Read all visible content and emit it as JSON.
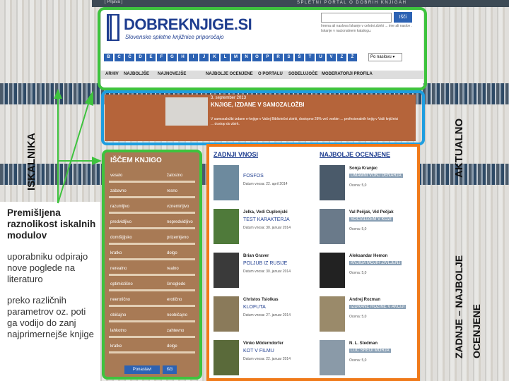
{
  "top_bar": {
    "login": "[ Prijava ]",
    "portal": "SPLETNI PORTAL O DOBRIH KNJIGAH"
  },
  "header": {
    "logo": "DOBREKNJIGE.SI",
    "tagline": "Slovenske spletne knjižnice priporočajo",
    "search_button": "Išči",
    "search_desc": "Imena ali naslova  Iskanje v celotni zbirki ... ime ali naslov . Iskanje v nacionalnem katalogu.",
    "letters": [
      "B",
      "C",
      "Č",
      "D",
      "E",
      "F",
      "G",
      "H",
      "I",
      "J",
      "K",
      "L",
      "M",
      "N",
      "O",
      "P",
      "R",
      "S",
      "Š",
      "T",
      "U",
      "V",
      "Z",
      "Ž"
    ],
    "sort_label": "Po naslovu"
  },
  "nav": [
    "ARHIV",
    "NAJBOLJŠE",
    "NAJNOVEJŠE",
    "NAJBOLJE OCENJENE",
    "O PORTALU",
    "SODELUJOČE",
    "MODERATORJI PROFILA"
  ],
  "news": {
    "date": "3. september 2013",
    "title": "KNJIGE, IZDANE V SAMOZALOŽBI",
    "desc": "V samozaložbi izdane e-knjige v Vašej Bibliotečni zbirki, dostopno 28% več vsebin ... profesionalnih knjig v Vaši knjižnici ... dostop do zbirk."
  },
  "search_panel": {
    "title": "IŠČEM KNJIGO",
    "pairs": [
      [
        "veselo",
        "žalostno"
      ],
      [
        "zabavno",
        "resno"
      ],
      [
        "razumljivo",
        "vznemirljivo"
      ],
      [
        "predvidljivo",
        "nepredvidljivo"
      ],
      [
        "domišljijsko",
        "prizemljeno"
      ],
      [
        "kratko",
        "dolgo"
      ],
      [
        "nerealno",
        "realno"
      ],
      [
        "optimistično",
        "črnogledo"
      ],
      [
        "neerotično",
        "erotično"
      ],
      [
        "običajno",
        "neobičajno"
      ],
      [
        "lahkotno",
        "zahtevno"
      ],
      [
        "kratke",
        "dolge"
      ]
    ],
    "reset_button": "Ponastavi",
    "search_button": "Išči"
  },
  "latest": {
    "title": "ZADNJI VNOSI",
    "entries": [
      {
        "author": "",
        "title": "FOSFOS",
        "meta": "Datum vnosa: 22. april 2014"
      },
      {
        "author": "Jelka, Vedi Cuplenjski",
        "title": "TEST KARAKTERJA",
        "meta": "Datum vnosa: 30. januar 2014"
      },
      {
        "author": "Brian Graver",
        "title": "POLJUB IZ RUSIJE",
        "meta": "Datum vnosa: 30. januar 2014"
      },
      {
        "author": "Christos Tsiolkas",
        "title": "KLOFUTA",
        "meta": "Datum vnosa: 27. januar 2014"
      },
      {
        "author": "Vinko Möderndorfer",
        "title": "KOT V FILMU",
        "meta": "Datum vnosa: 22. januar 2014"
      }
    ]
  },
  "best_rated": {
    "title": "NAJBOLJE OCENJENE",
    "entries": [
      {
        "author": "Sonja Kranjec",
        "title": "UMAMNI VONJ DENARJA",
        "rating": "Ocena: 5,0"
      },
      {
        "author": "Val Pečjak, Vid Pečjak",
        "title": "SOCIALIZEM V KOŽI",
        "rating": "Ocena: 5,0"
      },
      {
        "author": "Aleksandar Hemon",
        "title": "KNJIGA MOJIH ŽIVLJENJ",
        "rating": "Ocena: 5,0"
      },
      {
        "author": "Andrej Rozman",
        "title": "IZDRANE ROZINE V AKCIJI",
        "rating": "Ocena: 5,0"
      },
      {
        "author": "N. L. Stedman",
        "title": "LUČ SREDI MORJA",
        "rating": "Ocena: 5,0"
      }
    ]
  },
  "labels": {
    "iskalnika": "ISKALNIKA",
    "aktualno": "AKTUALNO",
    "zadnje": "ZADNJE – NAJBOLJE",
    "ocenjene": "OCENJENE"
  },
  "left_text": {
    "title": "Premišljena raznolikost iskalnih modulov",
    "p1": "uporabniku odpirajo nove poglede na literaturo",
    "p2": "preko različnih parametrov oz. poti ga vodijo do zanj najprimernejše knjige"
  },
  "colors": {
    "green": "#3ec33e",
    "blue": "#1e9ee0",
    "orange": "#f07a1a",
    "news": "#b5643a",
    "brand": "#1e3d8f"
  }
}
